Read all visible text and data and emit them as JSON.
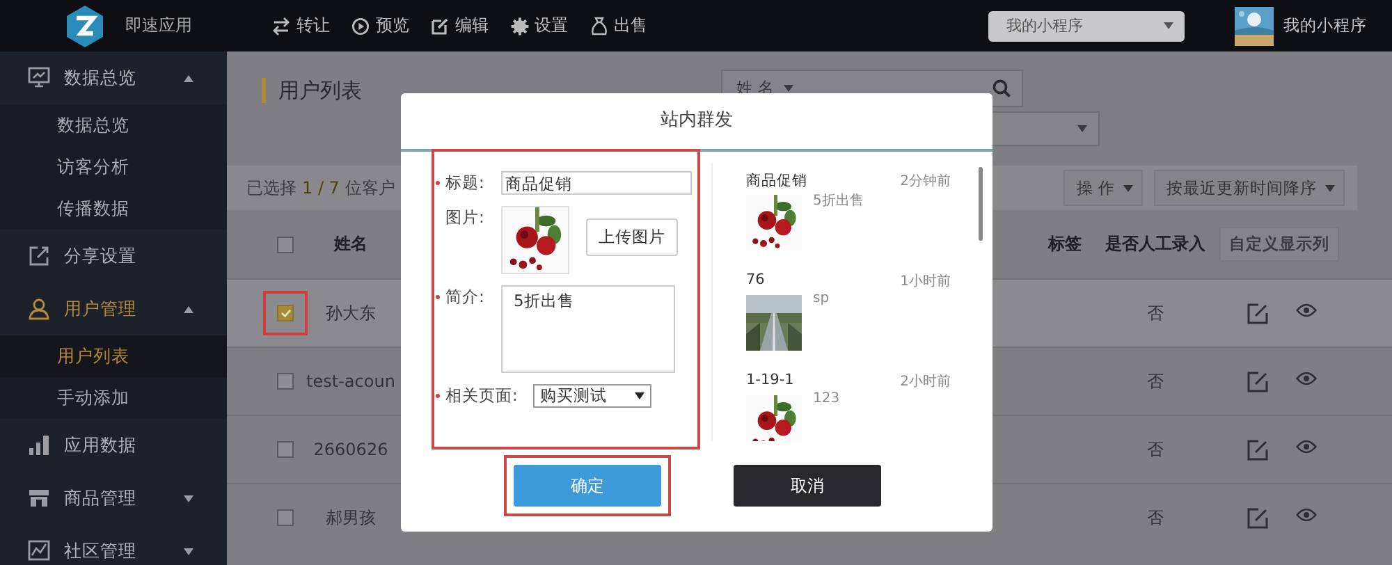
{
  "topbar": {
    "app_name": "即速应用",
    "nav": [
      {
        "label": "转让"
      },
      {
        "label": "预览"
      },
      {
        "label": "编辑"
      },
      {
        "label": "设置"
      },
      {
        "label": "出售"
      }
    ],
    "app_select": {
      "value": "我的小程序"
    },
    "account": {
      "name": "我的小程序"
    }
  },
  "sidebar": {
    "items": [
      {
        "label": "数据总览",
        "selected": false,
        "expanded": true,
        "children": [
          {
            "label": "数据总览",
            "selected": false
          },
          {
            "label": "访客分析",
            "selected": false
          },
          {
            "label": "传播数据",
            "selected": false
          }
        ]
      },
      {
        "label": "分享设置",
        "selected": false
      },
      {
        "label": "用户管理",
        "selected": true,
        "expanded": true,
        "children": [
          {
            "label": "用户列表",
            "selected": true
          },
          {
            "label": "手动添加",
            "selected": false
          }
        ]
      },
      {
        "label": "应用数据",
        "selected": false
      },
      {
        "label": "商品管理",
        "selected": false,
        "expanded": false
      },
      {
        "label": "社区管理",
        "selected": false,
        "expanded": false
      }
    ]
  },
  "page": {
    "title": "用户列表",
    "search_field": {
      "value": "姓 名"
    },
    "selection": {
      "prefix": "已选择",
      "count": "1 / 7",
      "suffix": "位客户"
    },
    "actions": [
      {
        "label": "操 作"
      },
      {
        "label": "按最近更新时间降序"
      }
    ],
    "table": {
      "header_checked": false,
      "columns": [
        {
          "label": "姓名"
        },
        {
          "label": "标签"
        },
        {
          "label": "是否人工录入"
        }
      ],
      "custom_button": "自定义显示列",
      "rows": [
        {
          "name": "孙大东",
          "manual": "否",
          "checked": true,
          "highlighted": true
        },
        {
          "name": "test-acoun",
          "manual": "否",
          "checked": false,
          "highlighted": false
        },
        {
          "name": "2660626",
          "manual": "否",
          "checked": false,
          "highlighted": false
        },
        {
          "name": "郝男孩",
          "manual": "否",
          "checked": false,
          "highlighted": false
        }
      ]
    }
  },
  "dialog": {
    "title": "站内群发",
    "form": {
      "highlighted": true,
      "fields": [
        {
          "kind": "text",
          "label": "标题:",
          "required": true,
          "value": "商品促销"
        },
        {
          "label": "图片:",
          "required": false,
          "button": "上传图片"
        },
        {
          "kind": "textarea",
          "label": "简介:",
          "required": true,
          "value": "5折出售"
        },
        {
          "kind": "select",
          "label": "相关页面:",
          "required": true,
          "value": "购买测试"
        }
      ]
    },
    "messages": [
      {
        "title": "商品促销",
        "time": "2分钟前",
        "summary": "5折出售"
      },
      {
        "title": "76",
        "time": "1小时前",
        "summary": "sp"
      },
      {
        "title": "1-19-1",
        "time": "2小时前",
        "summary": "123"
      }
    ],
    "buttons": [
      {
        "label": "确定",
        "kind": "primary",
        "highlighted": true
      },
      {
        "label": "取消",
        "kind": "secondary",
        "highlighted": false
      }
    ]
  }
}
